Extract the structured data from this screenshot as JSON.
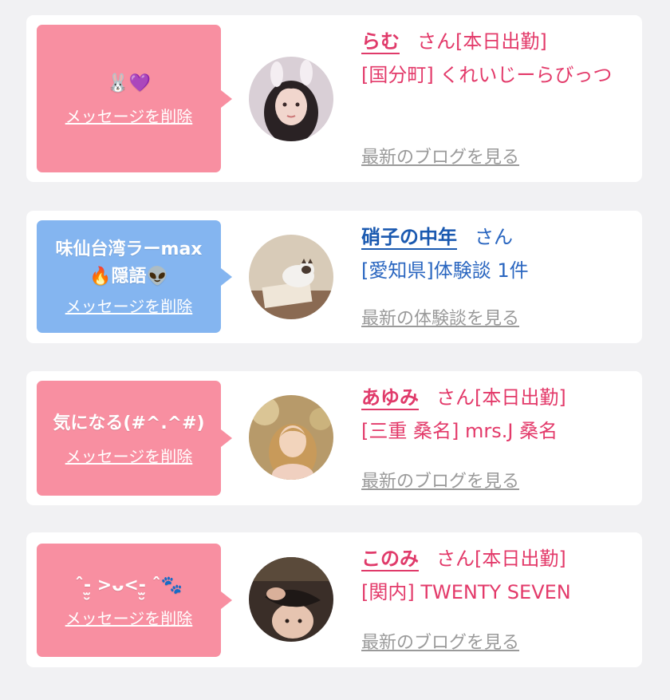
{
  "colors": {
    "pink_bubble": "#f88fa1",
    "blue_bubble": "#84b5f0",
    "pink_text": "#e33a6a",
    "blue_text": "#1a59b0",
    "link_gray": "#9a9a9a"
  },
  "cards": [
    {
      "bubble_message": "🐰💜",
      "delete_label": "メッセージを削除",
      "name": "らむ",
      "honorific": "さん",
      "status": "[本日出勤]",
      "detail": "[国分町] くれいじーらびっつ",
      "blog_link": "最新のブログを見る",
      "avatar_icon": "user-photo"
    },
    {
      "bubble_message": "味仙台湾ラーmax🔥隠語👽",
      "delete_label": "メッセージを削除",
      "name": "硝子の中年",
      "honorific": "さん",
      "status": "",
      "detail": "[愛知県]体験談 1件",
      "blog_link": "最新の体験談を見る",
      "avatar_icon": "cat-photo"
    },
    {
      "bubble_message": "気になる(#^.^#)",
      "delete_label": "メッセージを削除",
      "name": "あゆみ",
      "honorific": "さん",
      "status": "[本日出勤]",
      "detail": "[三重 桑名] mrs.J 桑名",
      "blog_link": "最新のブログを見る",
      "avatar_icon": "user-photo"
    },
    {
      "bubble_message": "ˆ-̫̮ >ᴗ<-̫̮ ˆ🐾",
      "delete_label": "メッセージを削除",
      "name": "このみ",
      "honorific": "さん",
      "status": "[本日出勤]",
      "detail": "[関内] TWENTY SEVEN",
      "blog_link": "最新のブログを見る",
      "avatar_icon": "user-photo"
    }
  ]
}
